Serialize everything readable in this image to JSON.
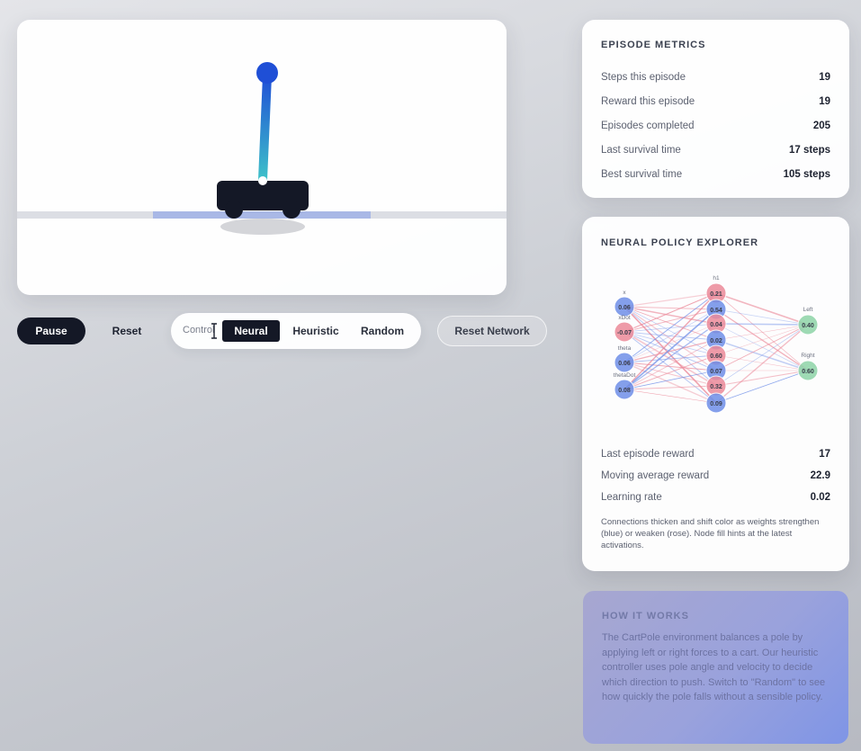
{
  "controls": {
    "pause_label": "Pause",
    "reset_label": "Reset",
    "control_label": "Control",
    "modes": [
      "Neural",
      "Heuristic",
      "Random"
    ],
    "active_mode": "Neural",
    "reset_network_label": "Reset Network"
  },
  "metrics": {
    "title": "EPISODE METRICS",
    "rows": [
      {
        "label": "Steps this episode",
        "value": "19"
      },
      {
        "label": "Reward this episode",
        "value": "19"
      },
      {
        "label": "Episodes completed",
        "value": "205"
      },
      {
        "label": "Last survival time",
        "value": "17 steps"
      },
      {
        "label": "Best survival time",
        "value": "105 steps"
      }
    ]
  },
  "explorer": {
    "title": "NEURAL POLICY EXPLORER",
    "network": {
      "inputs": [
        {
          "label": "x",
          "value": "0.06"
        },
        {
          "label": "xDot",
          "value": "-0.07"
        },
        {
          "label": "theta",
          "value": "0.06"
        },
        {
          "label": "thetaDot",
          "value": "0.08"
        }
      ],
      "hidden_label": "h1",
      "hidden": [
        "0.21",
        "0.54",
        "0.04",
        "0.02",
        "0.60",
        "0.07",
        "0.32",
        "0.09"
      ],
      "outputs": [
        {
          "label": "Left",
          "value": "0.40"
        },
        {
          "label": "Right",
          "value": "0.60"
        }
      ],
      "colors": {
        "positive": "#6f8fe8",
        "negative": "#ec8a9a",
        "output": "#8ed4a8"
      }
    },
    "stats": [
      {
        "label": "Last episode reward",
        "value": "17"
      },
      {
        "label": "Moving average reward",
        "value": "22.9"
      },
      {
        "label": "Learning rate",
        "value": "0.02"
      }
    ],
    "note": "Connections thicken and shift color as weights strengthen (blue) or weaken (rose). Node fill hints at the latest activations."
  },
  "how": {
    "title": "HOW IT WORKS",
    "text": "The CartPole environment balances a pole by applying left or right forces to a cart. Our heuristic controller uses pole angle and velocity to decide which direction to push. Switch to \"Random\" to see how quickly the pole falls without a sensible policy."
  },
  "colors": {
    "pole_top": "#1f4fd6",
    "pole_bottom": "#3ec1c9",
    "cart": "#141826",
    "track": "#dadce3",
    "track_highlight": "#a9b8e6"
  }
}
